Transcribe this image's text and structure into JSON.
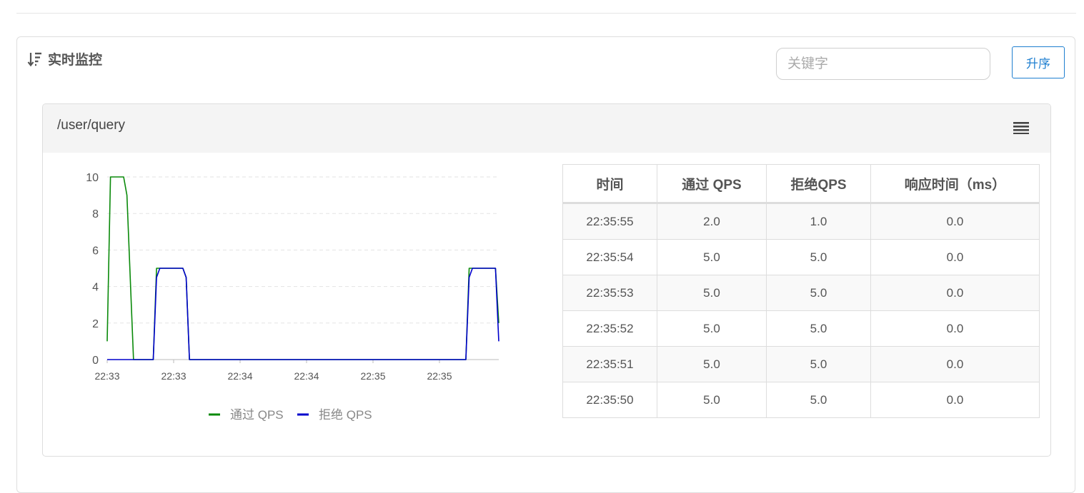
{
  "panel": {
    "title": "实时监控",
    "search": {
      "placeholder": "关键字",
      "value": ""
    },
    "sort_button_label": "升序"
  },
  "card": {
    "resource": "/user/query",
    "chart_data": {
      "type": "line",
      "title": "",
      "xlabel": "",
      "ylabel": "",
      "ylim": [
        0,
        10
      ],
      "y_ticks": [
        "0",
        "2",
        "4",
        "6",
        "8",
        "10"
      ],
      "x_ticks": [
        "22:33",
        "22:33",
        "22:34",
        "22:34",
        "22:35",
        "22:35"
      ],
      "grid": "horizontal dashed",
      "legend_position": "bottom",
      "x": [
        0,
        1,
        2,
        5,
        6,
        8,
        9,
        14,
        15,
        16,
        23,
        24,
        25,
        37,
        38,
        39,
        40,
        109,
        110,
        111,
        118,
        119
      ],
      "series": [
        {
          "name": "通过 QPS",
          "color": "#0a8a0a",
          "values": [
            1,
            10,
            10,
            10,
            9,
            0,
            0,
            0,
            5,
            5,
            5,
            4.5,
            0,
            0,
            0,
            0,
            0,
            0,
            5,
            5,
            5,
            2
          ]
        },
        {
          "name": "拒绝 QPS",
          "color": "#0000cc",
          "values": [
            0,
            0,
            0,
            0,
            0,
            0,
            0,
            0,
            4.5,
            5,
            5,
            4.5,
            0,
            0,
            0,
            0,
            0,
            0,
            4.5,
            5,
            5,
            1
          ]
        }
      ]
    },
    "table": {
      "headers": [
        "时间",
        "通过 QPS",
        "拒绝QPS",
        "响应时间（ms）"
      ],
      "rows": [
        [
          "22:35:55",
          "2.0",
          "1.0",
          "0.0"
        ],
        [
          "22:35:54",
          "5.0",
          "5.0",
          "0.0"
        ],
        [
          "22:35:53",
          "5.0",
          "5.0",
          "0.0"
        ],
        [
          "22:35:52",
          "5.0",
          "5.0",
          "0.0"
        ],
        [
          "22:35:51",
          "5.0",
          "5.0",
          "0.0"
        ],
        [
          "22:35:50",
          "5.0",
          "5.0",
          "0.0"
        ]
      ]
    }
  }
}
